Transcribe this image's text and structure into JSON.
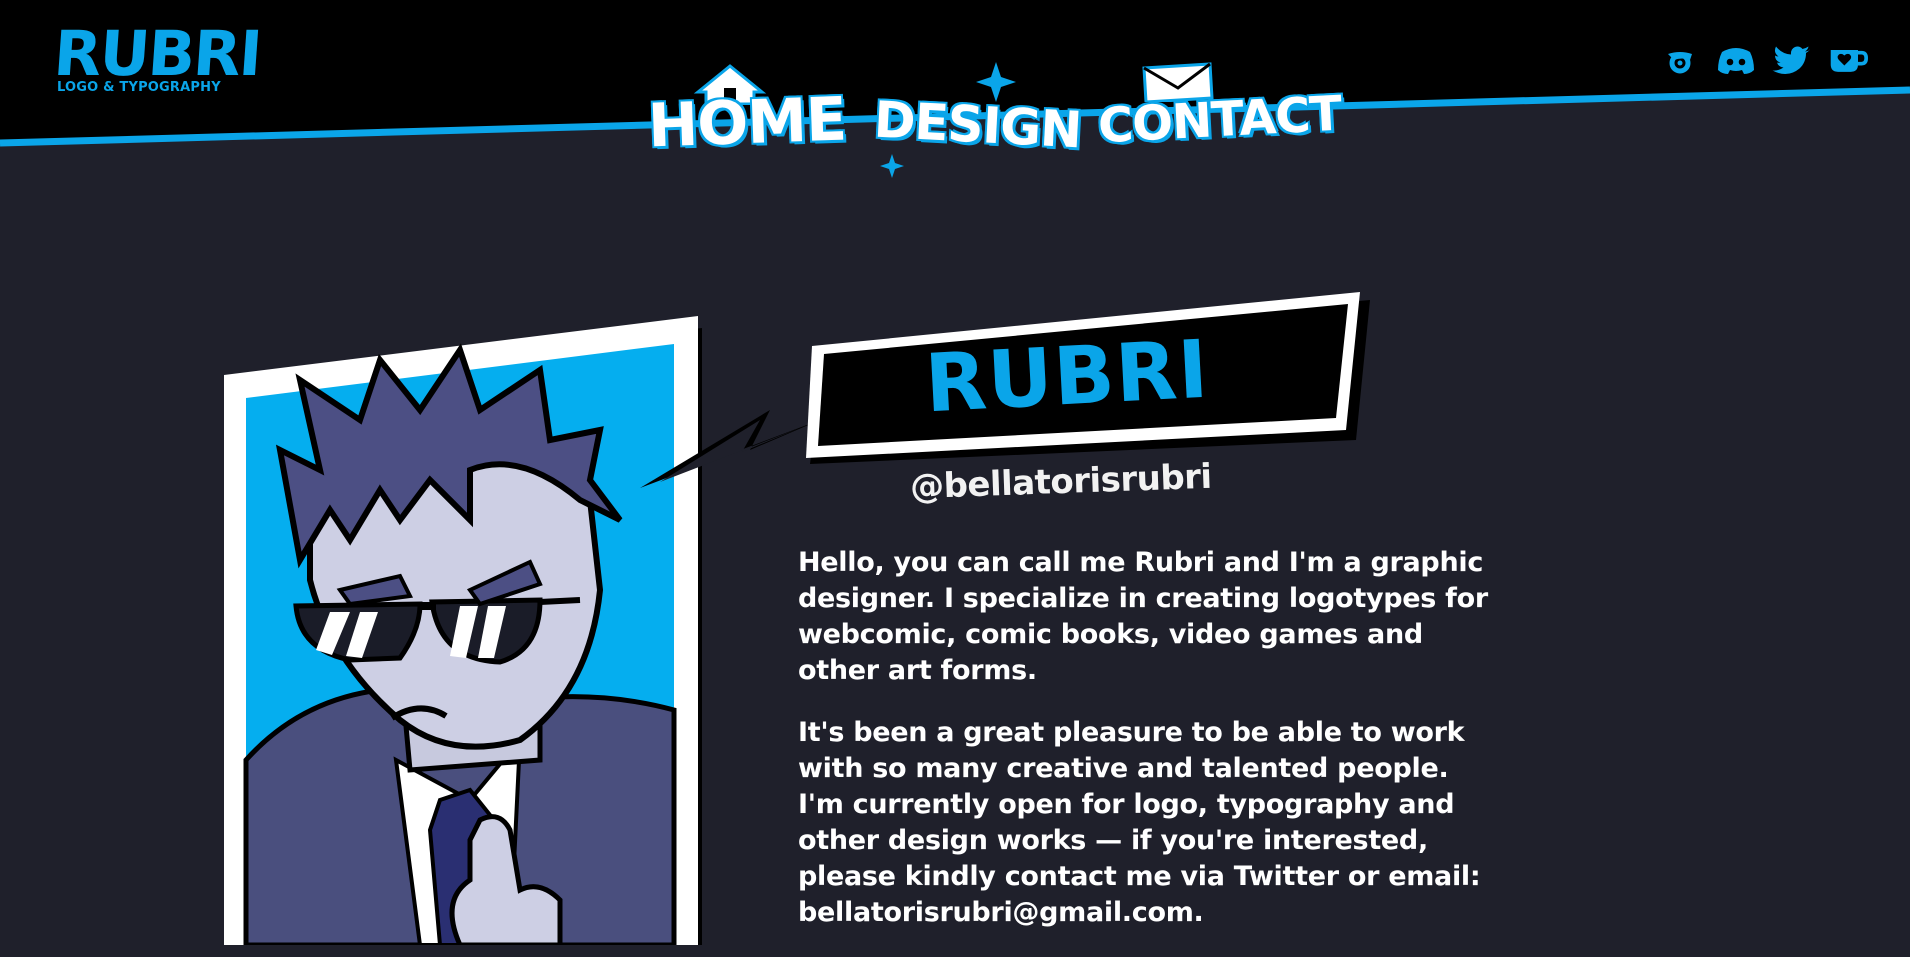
{
  "brand": {
    "name": "RUBRI",
    "tagline": "LOGO & TYPOGRAPHY"
  },
  "nav": {
    "home": "HOME",
    "design": "DESIGN",
    "contact": "CONTACT"
  },
  "socials": [
    {
      "icon": "gumroad-icon"
    },
    {
      "icon": "discord-icon"
    },
    {
      "icon": "twitter-icon"
    },
    {
      "icon": "kofi-icon"
    }
  ],
  "profile": {
    "name": "RUBRI",
    "handle": "@bellatorisrubri",
    "bio_1": "Hello, you can call me Rubri and I'm a graphic designer. I specialize in creating logotypes for webcomic, comic books, video games and other art forms.",
    "bio_2": "It's been a great pleasure to be able to work with so many creative and talented people. I'm currently open for logo, typography and other design works — if you're interested, please kindly contact me via Twitter or email: bellatorisrubri@gmail.com."
  },
  "colors": {
    "accent": "#0aa5e9",
    "background": "#1f202b",
    "header": "#000000"
  }
}
